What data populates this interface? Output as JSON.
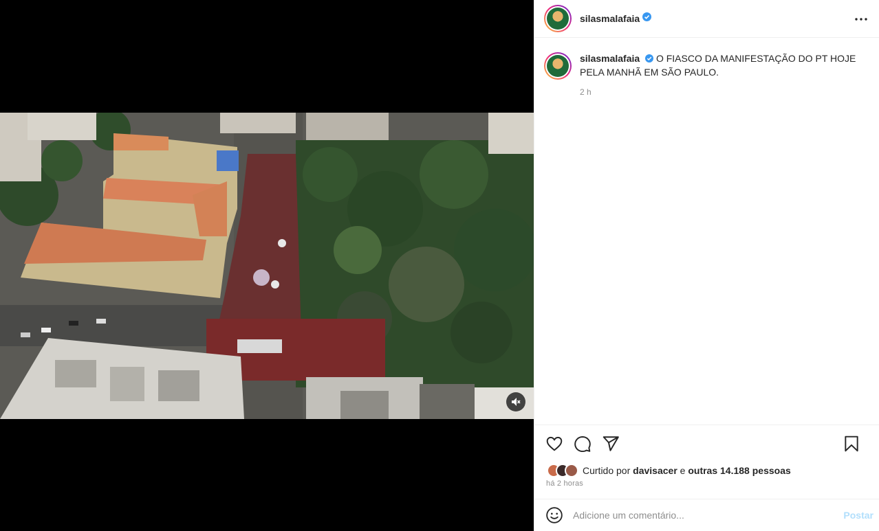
{
  "post": {
    "author": "silasmalafaia",
    "caption": "O FIASCO DA MANIFESTAÇÃO DO PT HOJE PELA MANHÃ EM SÃO PAULO.",
    "caption_time": "2 h",
    "liked_by_prefix": "Curtido por",
    "liked_by_user": "davisacer",
    "liked_by_connector": "e",
    "liked_by_others": "outras 14.188 pessoas",
    "post_time": "há 2 horas"
  },
  "comment": {
    "placeholder": "Adicione um comentário...",
    "post_label": "Postar"
  },
  "icons": {
    "verified": "verified-badge-icon",
    "more": "more-options-icon",
    "like": "heart-icon",
    "comment": "comment-bubble-icon",
    "share": "share-paper-plane-icon",
    "save": "bookmark-icon",
    "emoji": "emoji-icon",
    "mute": "speaker-muted-icon"
  },
  "colors": {
    "verified": "#3897f0",
    "post_button_disabled": "#b2dffc",
    "secondary_text": "#8e8e8e"
  }
}
